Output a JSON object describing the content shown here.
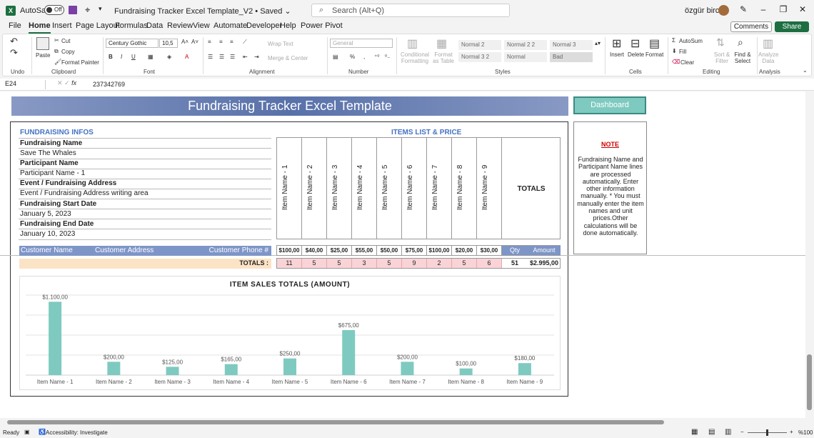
{
  "titlebar": {
    "autosave_label": "AutoSave",
    "autosave_state": "Off",
    "doc_title": "Fundraising Tracker Excel Template_V2 • Saved ⌄",
    "search_placeholder": "Search (Alt+Q)",
    "user_name": "özgür bircan"
  },
  "tabs": [
    "File",
    "Home",
    "Insert",
    "Page Layout",
    "Formulas",
    "Data",
    "Review",
    "View",
    "Automate",
    "Developer",
    "Help",
    "Power Pivot"
  ],
  "active_tab": "Home",
  "comments_label": "Comments",
  "share_label": "Share",
  "ribbon": {
    "undo_label": "Undo",
    "paste_label": "Paste",
    "cut_label": "Cut",
    "copy_label": "Copy",
    "format_painter_label": "Format Painter",
    "clipboard_label": "Clipboard",
    "font_name": "Century Gothic",
    "font_size": "10,5",
    "font_label": "Font",
    "wrap_text_label": "Wrap Text",
    "merge_center_label": "Merge & Center",
    "alignment_label": "Alignment",
    "number_format": "General",
    "number_label": "Number",
    "conditional_formatting_label": "Conditional Formatting",
    "format_as_table_label": "Format as Table",
    "styles": [
      "Normal 2",
      "Normal 2 2",
      "Normal 3",
      "Normal 3 2",
      "Normal",
      "Bad"
    ],
    "styles_label": "Styles",
    "insert_label": "Insert",
    "delete_label": "Delete",
    "format_label": "Format",
    "cells_label": "Cells",
    "autosum_label": "AutoSum",
    "fill_label": "Fill",
    "clear_label": "Clear",
    "sort_filter_label": "Sort & Filter",
    "find_select_label": "Find & Select",
    "editing_label": "Editing",
    "analyze_data_label": "Analyze Data",
    "analysis_label": "Analysis"
  },
  "formula_bar": {
    "name_box": "E24",
    "value": "237342769"
  },
  "sheet": {
    "title": "Fundraising Tracker Excel Template",
    "dashboard_label": "Dashboard",
    "infos_header": "FUNDRAISING INFOS",
    "items_header": "ITEMS LIST & PRICE",
    "fields": [
      {
        "label": "Fundraising Name",
        "value": "Save The Whales"
      },
      {
        "label": "Participant Name",
        "value": "Participant Name - 1"
      },
      {
        "label": "Event / Fundraising Address",
        "value": "Event / Fundraising Address writing area"
      },
      {
        "label": "Fundraising Start Date",
        "value": "January 5, 2023"
      },
      {
        "label": "Fundraising End Date",
        "value": "January 10, 2023"
      }
    ],
    "items": [
      "Item Name - 1",
      "Item Name - 2",
      "Item Name - 3",
      "Item Name - 4",
      "Item Name - 5",
      "Item Name - 6",
      "Item Name - 7",
      "Item Name - 8",
      "Item Name - 9"
    ],
    "totals_header": "TOTALS",
    "customer_name_label": "Customer Name",
    "customer_address_label": "Customer Address",
    "customer_phone_label": "Customer Phone #",
    "prices": [
      "$100,00",
      "$40,00",
      "$25,00",
      "$55,00",
      "$50,00",
      "$75,00",
      "$100,00",
      "$20,00",
      "$30,00"
    ],
    "qty_label": "Qty",
    "amount_label": "Amount",
    "totals_label": "TOTALS :",
    "quantities": [
      "11",
      "5",
      "5",
      "3",
      "5",
      "9",
      "2",
      "5",
      "6"
    ],
    "total_qty": "51",
    "total_amount": "$2.995,00",
    "note_title": "NOTE",
    "note_body": "Fundraising Name and Participant Name lines are processed automatically. Enter other information manually. * You must manually enter the item names and unit prices.Other calculations will be done automatically."
  },
  "chart_data": {
    "type": "bar",
    "title": "ITEM SALES TOTALS (AMOUNT)",
    "categories": [
      "Item Name - 1",
      "Item Name - 2",
      "Item Name - 3",
      "Item Name - 4",
      "Item Name - 5",
      "Item Name - 6",
      "Item Name - 7",
      "Item Name - 8",
      "Item Name - 9"
    ],
    "values": [
      1100,
      200,
      125,
      165,
      250,
      675,
      200,
      100,
      180
    ],
    "data_labels": [
      "$1.100,00",
      "$200,00",
      "$125,00",
      "$165,00",
      "$250,00",
      "$675,00",
      "$200,00",
      "$100,00",
      "$180,00"
    ],
    "ylim": [
      0,
      1200
    ],
    "grid": true,
    "bar_color": "#7ecac0"
  },
  "statusbar": {
    "ready_label": "Ready",
    "accessibility_label": "Accessibility: Investigate",
    "zoom_label": "%100"
  },
  "colors": {
    "excel_green": "#1d6f42",
    "header_blue": "#4472c4",
    "band_blue": "#7e95c8",
    "totals_bg": "#fbe3c6",
    "qty_pink": "#f9d3d6",
    "teal": "#7ecac0",
    "note_red": "#cc0000"
  }
}
